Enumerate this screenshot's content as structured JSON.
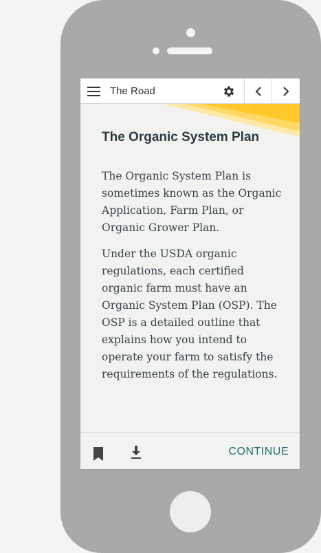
{
  "header": {
    "title": "The Road"
  },
  "content": {
    "heading": "The Organic System Plan",
    "paragraphs": [
      "The Organic System Plan is sometimes known as the Organic Application, Farm Plan, or Organic Grower Plan.",
      "Under the USDA organic regulations, each certified organic farm must have an Organic System Plan (OSP). The OSP is a detailed outline that explains how you intend to operate your farm to satisfy the requirements of the regulations."
    ]
  },
  "footer": {
    "continue_label": "CONTINUE"
  },
  "colors": {
    "accent": "#1f6d70",
    "banner_yellow": "#ffc82c",
    "phone_body": "#a9a9a9"
  },
  "icons": [
    "menu-icon",
    "gear-icon",
    "chevron-left-icon",
    "chevron-right-icon",
    "bookmark-icon",
    "download-icon"
  ]
}
